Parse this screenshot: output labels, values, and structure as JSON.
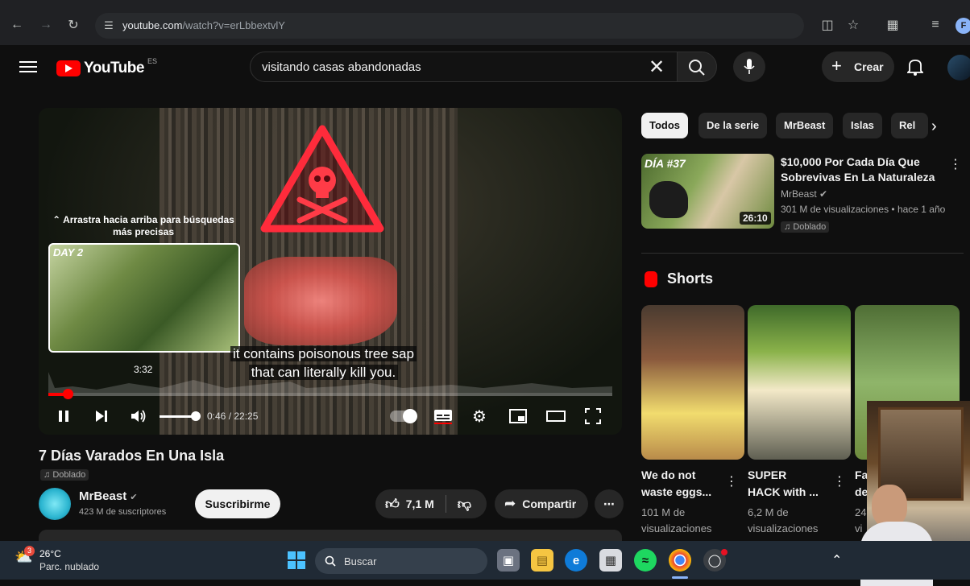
{
  "browser": {
    "url_host": "youtube.com",
    "url_path": "/watch?v=erLbbextvlY",
    "profile_initial": "F"
  },
  "header": {
    "logo_text": "YouTube",
    "region": "ES",
    "search_value": "visitando casas abandonadas",
    "create_label": "Crear"
  },
  "player": {
    "drag_hint": "Arrastra hacia arriba para búsquedas más precisas",
    "preview_label": "DAY 2",
    "preview_time": "3:32",
    "caption_line1": "it contains poisonous tree sap",
    "caption_line2": "that can literally kill you.",
    "current_time": "0:46 / 22:25",
    "progress_fraction": 0.034,
    "volume_fraction": 0.85
  },
  "video": {
    "title": "7 Días Varados En Una Isla",
    "dubbed_label": "Doblado",
    "channel_name": "MrBeast",
    "subscribers": "423 M de suscriptores",
    "subscribe_label": "Suscribirme",
    "likes": "7,1 M",
    "share_label": "Compartir"
  },
  "chips": [
    "Todos",
    "De la serie",
    "MrBeast",
    "Islas",
    "Rel"
  ],
  "recommended": {
    "thumb_label": "DÍA #37",
    "title_line1": "$10,000 Por Cada Día Que",
    "title_line2": "Sobrevivas En La Naturaleza",
    "channel": "MrBeast",
    "meta": "301 M de visualizaciones • hace 1 año",
    "duration": "26:10",
    "dubbed_label": "Doblado"
  },
  "shorts": {
    "heading": "Shorts",
    "items": [
      {
        "title_line1": "We do not",
        "title_line2": "waste eggs...",
        "views_line1": "101 M de",
        "views_line2": "visualizaciones"
      },
      {
        "title_line1": "SUPER",
        "title_line2": "HACK with ...",
        "views_line1": "6,2 M de",
        "views_line2": "visualizaciones"
      },
      {
        "title_line1": "Fa",
        "title_line2": "de",
        "views_line1": "24",
        "views_line2": "vi"
      }
    ]
  },
  "taskbar": {
    "temperature": "26°C",
    "weather": "Parc. nublado",
    "search_label": "Buscar",
    "notification_count": "3"
  },
  "colors": {
    "accent": "#ff0000",
    "background": "#0f0f0f"
  }
}
